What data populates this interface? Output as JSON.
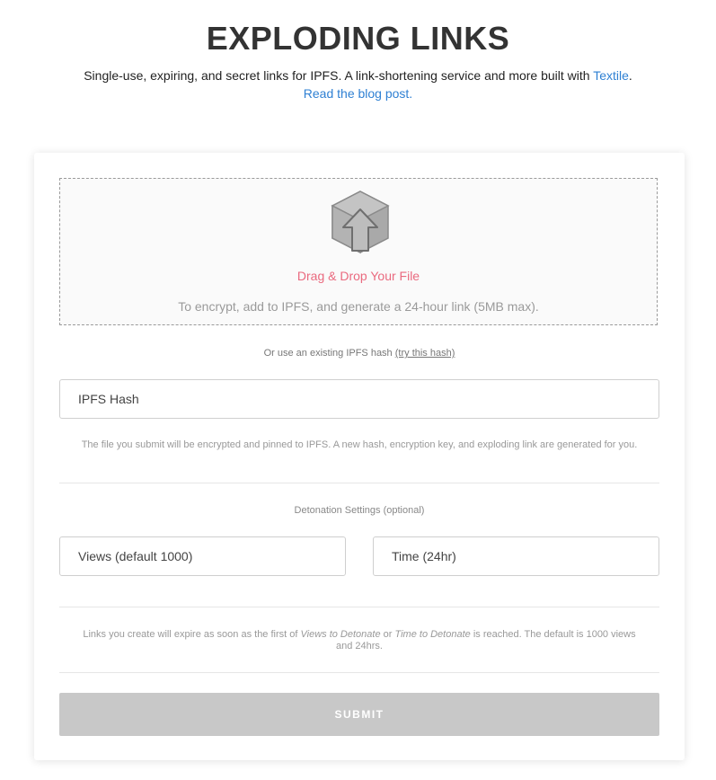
{
  "header": {
    "title": "EXPLODING LINKS",
    "subtitle_text": "Single-use, expiring, and secret links for IPFS. A link-shortening service and more built with ",
    "subtitle_link": "Textile",
    "subtitle_end": ".",
    "blog_link": "Read the blog post."
  },
  "dropzone": {
    "icon": "upload-box-icon",
    "title": "Drag & Drop Your File",
    "subtitle": "To encrypt, add to IPFS, and generate a 24-hour link (5MB max)."
  },
  "hash": {
    "or_text": "Or use an existing IPFS hash ",
    "try_link": "(try this hash)",
    "placeholder": "IPFS Hash",
    "note": "The file you submit will be encrypted and pinned to IPFS. A new hash, encryption key, and exploding link are generated for you."
  },
  "detonation": {
    "heading": "Detonation Settings (optional)",
    "views_placeholder": "Views (default 1000)",
    "time_placeholder": "Time (24hr)",
    "note_start": "Links you create will expire as soon as the first of ",
    "note_views": "Views to Detonate",
    "note_or": " or ",
    "note_time": "Time to Detonate",
    "note_end": " is reached. The default is 1000 views and 24hrs."
  },
  "submit_label": "SUBMIT",
  "colors": {
    "accent_link": "#2f80d3",
    "drop_title": "#ea6a7f",
    "submit_disabled": "#c8c8c8"
  }
}
